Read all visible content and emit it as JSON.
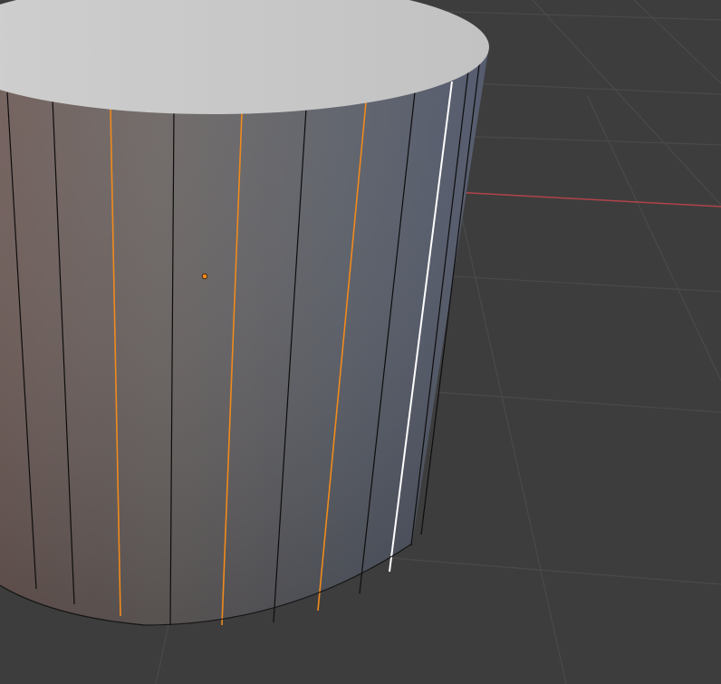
{
  "scene": {
    "view": "3d-viewport",
    "mode": "edit",
    "object": "cylinder",
    "background": "#3d3d3d",
    "grid_line_color": "#4a4a4a",
    "x_axis_color": "#b1434a",
    "edge_color": "#0d0d0d",
    "selected_edge_color": "#f08a1c",
    "active_edge_color": "#ffffff",
    "cap_color": "#c9c9c9",
    "origin_color": "#f08a1c",
    "selected_edges": 3,
    "active_edges": 1
  }
}
